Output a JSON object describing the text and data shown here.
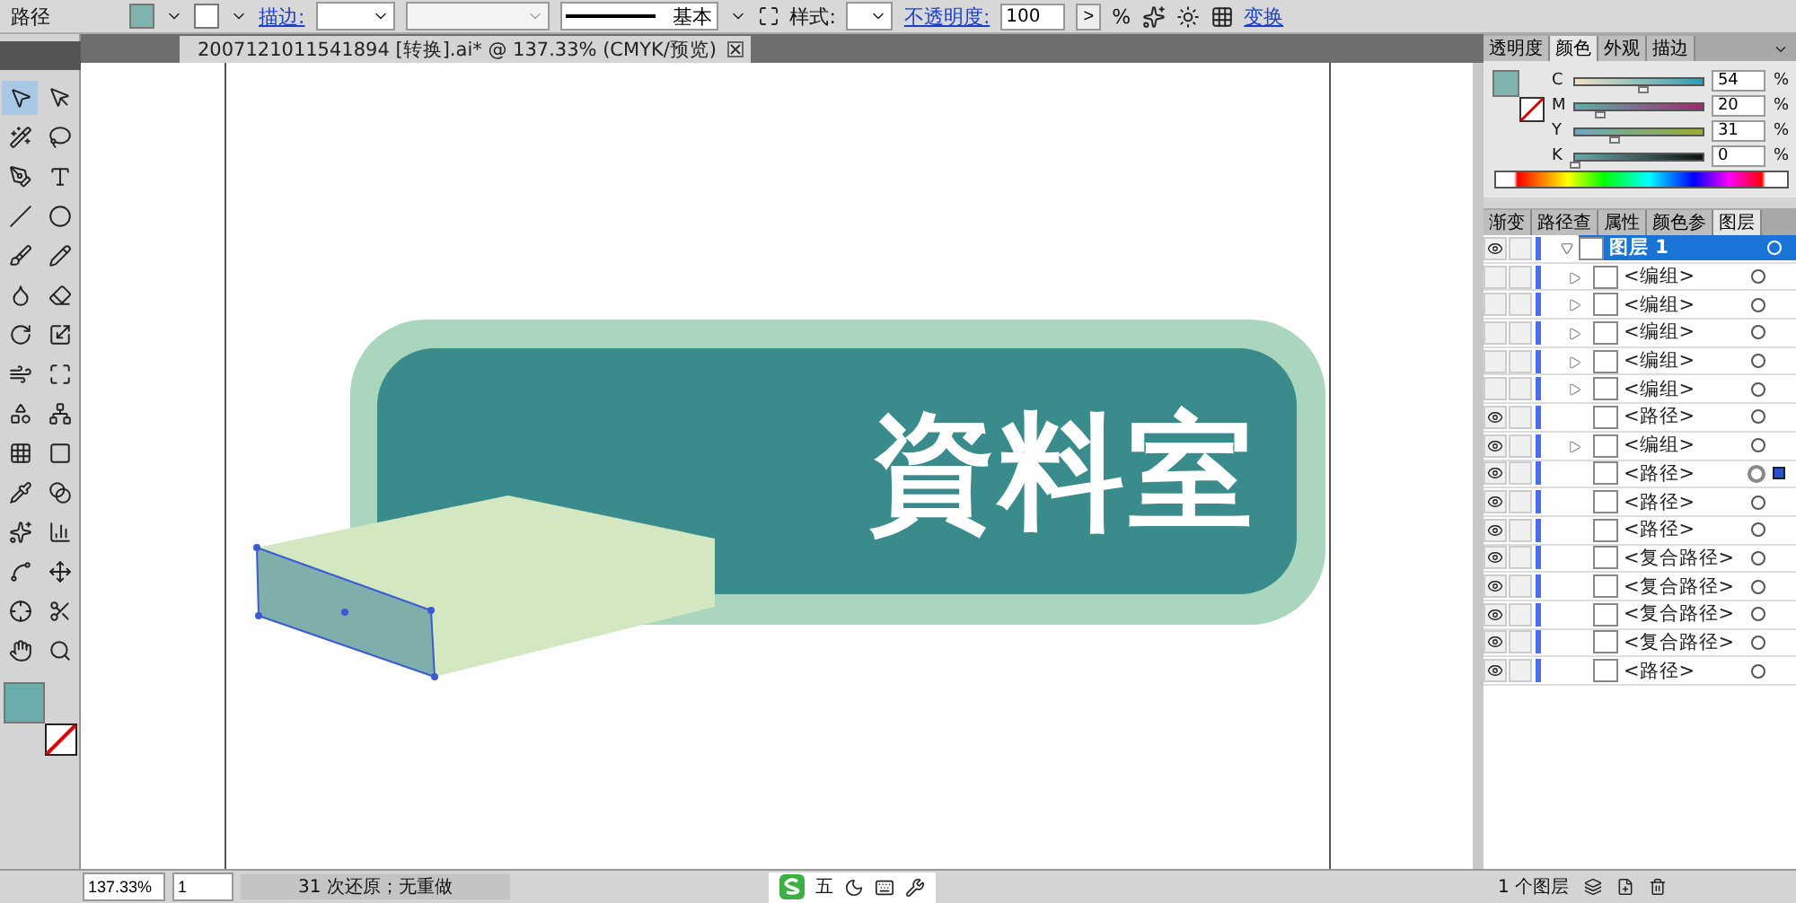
{
  "control_bar": {
    "object_type": "路径",
    "stroke_label": "描边:",
    "stroke_profile": "基本",
    "style_label": "样式:",
    "opacity_label": "不透明度:",
    "opacity_value": "100",
    "opacity_step": ">",
    "percent": "%",
    "transform_link": "变换"
  },
  "document_tab": {
    "title": "2007121011541894 [转换].ai* @ 137.33% (CMYK/预览)"
  },
  "artwork": {
    "banner_text": "資料室"
  },
  "color_panel": {
    "tabs": [
      {
        "label": "透明度",
        "selected": false
      },
      {
        "label": "颜色",
        "selected": true
      },
      {
        "label": "外观",
        "selected": false
      },
      {
        "label": "描边",
        "selected": false
      }
    ],
    "channels": [
      {
        "label": "C",
        "value": "54",
        "level": 0.54
      },
      {
        "label": "M",
        "value": "20",
        "level": 0.2
      },
      {
        "label": "Y",
        "value": "31",
        "level": 0.31
      },
      {
        "label": "K",
        "value": "0",
        "level": 0
      }
    ],
    "percent": "%"
  },
  "layers_panel": {
    "tabs": [
      {
        "label": "渐变",
        "selected": false
      },
      {
        "label": "路径查",
        "selected": false
      },
      {
        "label": "属性",
        "selected": false
      },
      {
        "label": "颜色参",
        "selected": false
      },
      {
        "label": "图层",
        "selected": true
      }
    ],
    "layer": {
      "name": "图层 1",
      "visible": true,
      "expanded": true,
      "selected": true
    },
    "children": [
      {
        "name": "<编组>",
        "visible": false,
        "expandable": true,
        "selected": false
      },
      {
        "name": "<编组>",
        "visible": false,
        "expandable": true,
        "selected": false
      },
      {
        "name": "<编组>",
        "visible": false,
        "expandable": true,
        "selected": false
      },
      {
        "name": "<编组>",
        "visible": false,
        "expandable": true,
        "selected": false
      },
      {
        "name": "<编组>",
        "visible": false,
        "expandable": true,
        "selected": false
      },
      {
        "name": "<路径>",
        "visible": true,
        "expandable": false,
        "selected": false
      },
      {
        "name": "<编组>",
        "visible": true,
        "expandable": true,
        "selected": false
      },
      {
        "name": "<路径>",
        "visible": true,
        "expandable": false,
        "selected": true
      },
      {
        "name": "<路径>",
        "visible": true,
        "expandable": false,
        "selected": false
      },
      {
        "name": "<路径>",
        "visible": true,
        "expandable": false,
        "selected": false
      },
      {
        "name": "<复合路径>",
        "visible": true,
        "expandable": false,
        "selected": false
      },
      {
        "name": "<复合路径>",
        "visible": true,
        "expandable": false,
        "selected": false
      },
      {
        "name": "<复合路径>",
        "visible": true,
        "expandable": false,
        "selected": false
      },
      {
        "name": "<复合路径>",
        "visible": true,
        "expandable": false,
        "selected": false
      },
      {
        "name": "<路径>",
        "visible": true,
        "expandable": false,
        "selected": false
      }
    ],
    "layer_count": "1 个图层"
  },
  "status_bar": {
    "zoom": "137.33%",
    "page": "1",
    "history": "31 次还原；无重做",
    "ime_mode": "五"
  }
}
